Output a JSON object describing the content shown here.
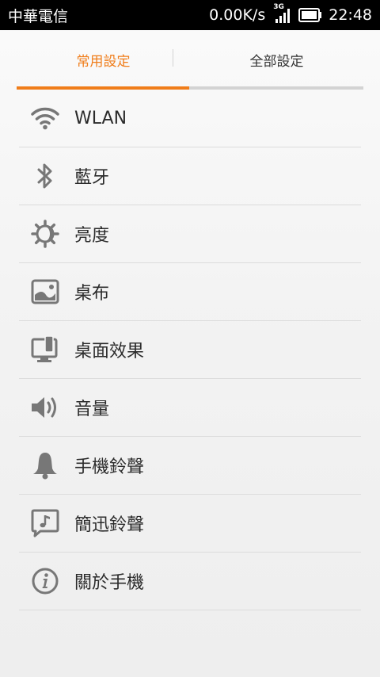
{
  "status_bar": {
    "carrier": "中華電信",
    "network_speed": "0.00K/s",
    "network_type": "3G",
    "time": "22:48"
  },
  "tabs": [
    {
      "label": "常用設定",
      "active": true
    },
    {
      "label": "全部設定",
      "active": false
    }
  ],
  "colors": {
    "accent": "#f07d1a",
    "icon": "#777777"
  },
  "settings_list": [
    {
      "label": "WLAN",
      "icon": "wifi-icon"
    },
    {
      "label": "藍牙",
      "icon": "bluetooth-icon"
    },
    {
      "label": "亮度",
      "icon": "brightness-icon"
    },
    {
      "label": "桌布",
      "icon": "wallpaper-icon"
    },
    {
      "label": "桌面效果",
      "icon": "desktop-effects-icon"
    },
    {
      "label": "音量",
      "icon": "volume-icon"
    },
    {
      "label": "手機鈴聲",
      "icon": "bell-icon"
    },
    {
      "label": "簡迅鈴聲",
      "icon": "sms-ringtone-icon"
    },
    {
      "label": "關於手機",
      "icon": "info-icon"
    }
  ]
}
